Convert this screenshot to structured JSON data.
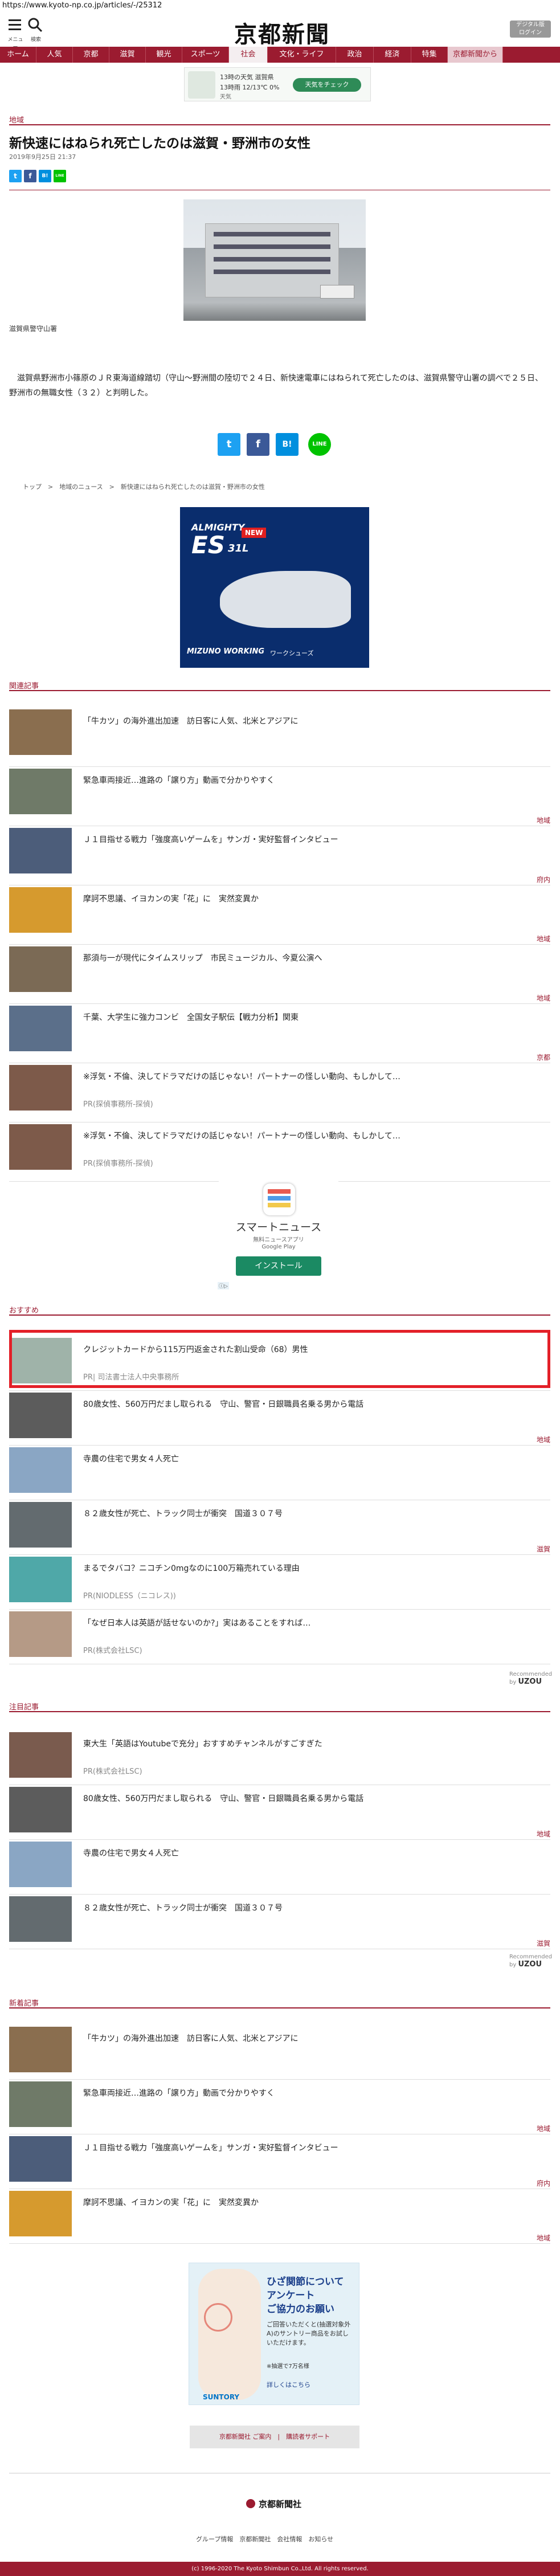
{
  "url": "https://www.kyoto-np.co.jp/articles/-/25312",
  "header": {
    "menu_label": "メニュー",
    "search_label": "検索",
    "logo": "京都新聞",
    "login_line1": "デジタル版",
    "login_line2": "ログイン"
  },
  "nav": {
    "items": [
      "ホーム",
      "人気",
      "京都",
      "滋賀",
      "観光",
      "スポーツ",
      "社会",
      "文化・ライフ",
      "政治",
      "経済",
      "特集",
      "京都新聞から"
    ],
    "active": "社会"
  },
  "weather_ad": {
    "line1": "13時の天気 滋賀県",
    "line2": "13時雨 12/13℃ 0%",
    "line3": "天気",
    "button": "天気をチェック"
  },
  "article": {
    "category": "地域",
    "title": "新快速にはねられ死亡したのは滋賀・野洲市の女性",
    "date": "2019年9月25日 21:37",
    "caption": "滋賀県警守山署",
    "body": "滋賀県野洲市小篠原のＪＲ東海道線踏切（守山～野洲間の陸切で２４日、新快速電車にはねられて死亡したのは、滋賀県警守山署の調べで２５日、野洲市の無職女性（３２）と判明した。",
    "share": {
      "twitter": "t",
      "facebook": "f",
      "hatena": "B!",
      "line": "LINE"
    },
    "breadcrumb": [
      "トップ",
      "地域のニュース",
      "新快速にはねられ死亡したのは滋賀・野洲市の女性"
    ]
  },
  "shoe_ad": {
    "brand": "ALMIGHTY",
    "model": "ES",
    "model_sub": "31L",
    "badge": "NEW",
    "footer": "MIZUNO WORKING",
    "footer_jp": "ワークシューズ"
  },
  "related": {
    "label": "関連記事",
    "items": [
      {
        "headline": "「牛カツ」の海外進出加速　訪日客に人気、北米とアジアに",
        "cat": "",
        "sponsor": ""
      },
      {
        "headline": "緊急車両接近…進路の「譲り方」動画で分かりやすく",
        "cat": "地域",
        "sponsor": ""
      },
      {
        "headline": "Ｊ１目指せる戦力「強度高いゲームを」サンガ・実好監督インタビュー",
        "cat": "府内",
        "sponsor": ""
      },
      {
        "headline": "摩訶不思議、イヨカンの実「花」に　実然変異か",
        "cat": "地域",
        "sponsor": ""
      },
      {
        "headline": "那須与一が現代にタイムスリップ　市民ミュージカル、今夏公演へ",
        "cat": "地域",
        "sponsor": ""
      },
      {
        "headline": "千葉、大学生に強力コンビ　全国女子駅伝【戦力分析】関東",
        "cat": "京都",
        "sponsor": ""
      },
      {
        "headline": "※浮気・不倫、決してドラマだけの話じゃない！パートナーの怪しい動向、もしかして…",
        "cat": "",
        "sponsor": "PR(探偵事務所-探偵)"
      },
      {
        "headline": "※浮気・不倫、決してドラマだけの話じゃない！パートナーの怪しい動向、もしかして…",
        "cat": "",
        "sponsor": "PR(探偵事務所-探偵)"
      }
    ]
  },
  "news_ad": {
    "title": "スマートニュース",
    "sub": "無料ニュースアプリ",
    "store": "Google Play",
    "button": "インストール"
  },
  "recommend": {
    "label": "おすすめ",
    "items": [
      {
        "headline": "クレジットカードから115万円返金された割山受命（68）男性",
        "cat": "",
        "sponsor": "PR| 司法書士法人中央事務所"
      },
      {
        "headline": "80歳女性、560万円だまし取られる　守山、警官・日銀職員名乗る男から電話",
        "cat": "地域",
        "sponsor": ""
      },
      {
        "headline": "寺農の住宅で男女４人死亡",
        "cat": "",
        "sponsor": ""
      },
      {
        "headline": "８２歳女性が死亡、トラック同士が衝突　国道３０７号",
        "cat": "滋賀",
        "sponsor": ""
      },
      {
        "headline": "まるでタバコ？ニコチン0mgなのに100万箱売れている理由",
        "cat": "",
        "sponsor": "PR(NIODLESS（ニコレス))"
      },
      {
        "headline": "「なぜ日本人は英語が話せないのか?」実はあることをすれば…",
        "cat": "",
        "sponsor": "PR(株式会社LSC)"
      }
    ],
    "recommended_by": "Recommended by",
    "uzou": "UZOU"
  },
  "attention": {
    "label": "注目記事",
    "items": [
      {
        "headline": "東大生「英語はYoutubeで充分」おすすめチャンネルがすごすぎた",
        "cat": "",
        "sponsor": "PR(株式会社LSC)"
      },
      {
        "headline": "80歳女性、560万円だまし取られる　守山、警官・日銀職員名乗る男から電話",
        "cat": "地域",
        "sponsor": ""
      },
      {
        "headline": "寺農の住宅で男女４人死亡",
        "cat": "",
        "sponsor": ""
      },
      {
        "headline": "８２歳女性が死亡、トラック同士が衝突　国道３０７号",
        "cat": "滋賀",
        "sponsor": ""
      }
    ],
    "recommended_by": "Recommended by",
    "uzou": "UZOU"
  },
  "latest": {
    "label": "新着記事",
    "items": [
      {
        "headline": "「牛カツ」の海外進出加速　訪日客に人気、北米とアジアに",
        "cat": ""
      },
      {
        "headline": "緊急車両接近…進路の「譲り方」動画で分かりやすく",
        "cat": "地域"
      },
      {
        "headline": "Ｊ１目指せる戦力「強度高いゲームを」サンガ・実好監督インタビュー",
        "cat": "府内"
      },
      {
        "headline": "摩訶不思議、イヨカンの実「花」に　実然変異か",
        "cat": "地域"
      }
    ]
  },
  "survey_ad": {
    "line1": "ひざ関節について",
    "line2": "アンケート",
    "line3": "ご協力のお願い",
    "body": "ご回答いただくと(抽選対象外A)のサントリー商品をお試しいただけます。",
    "note": "※抽選で7万名様",
    "link": "詳しくはこちら",
    "brand": "SUNTORY"
  },
  "footer": {
    "btn1": "京都新聞社 ご案内",
    "sep": "|",
    "btn2": "購読者サポート",
    "logo": "京都新聞社",
    "links": "グループ情報　京都新聞社　会社情報　お知らせ",
    "copyright": "(c) 1996-2020 The Kyoto Shimbun Co.,Ltd. All rights reserved."
  },
  "colors": {
    "brand": "#9b1b30",
    "highlight_box": "#e32028",
    "twitter": "#1da1f2",
    "facebook": "#3b5998",
    "hatena": "#008fde",
    "line": "#00c300"
  }
}
